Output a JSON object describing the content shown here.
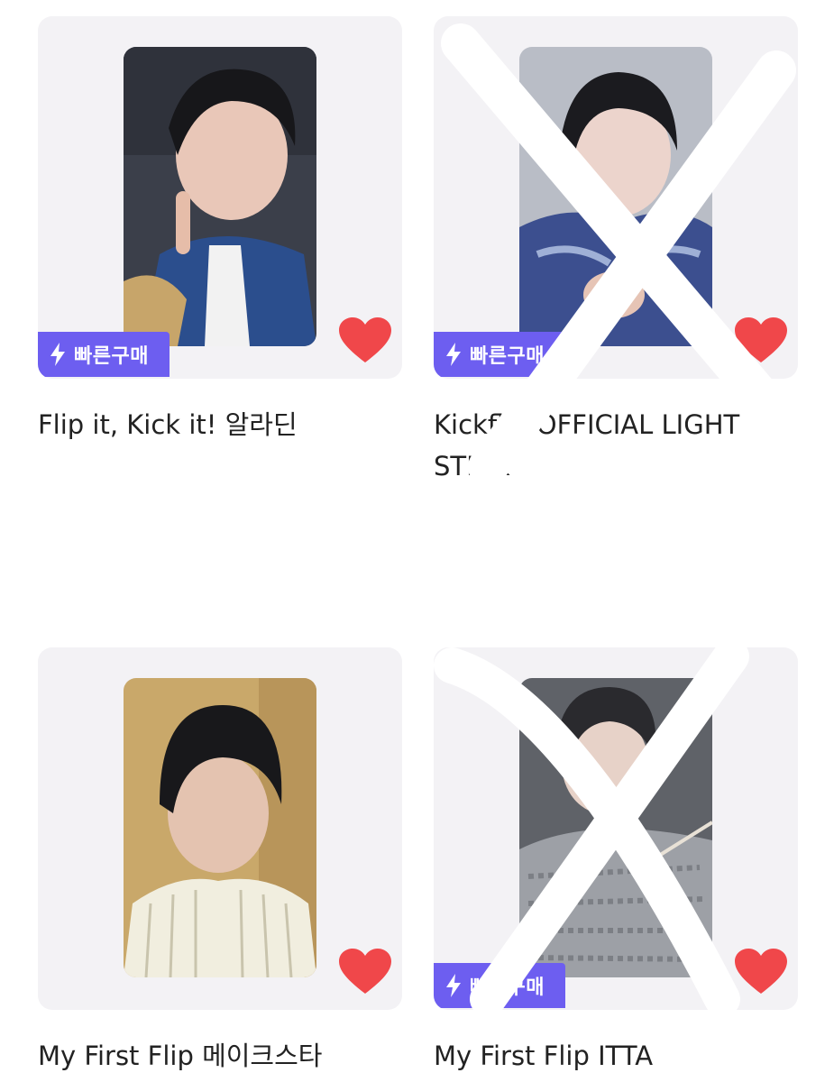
{
  "products": [
    {
      "title": "Flip it, Kick it! 알라딘",
      "badge_label": "빠른구매",
      "badge_icon": "lightning-icon",
      "liked": true,
      "crossed_out": false
    },
    {
      "title": "Kickflip OFFICIAL LIGHT STICK",
      "badge_label": "빠른구매",
      "badge_icon": "lightning-icon",
      "liked": true,
      "crossed_out": true
    },
    {
      "title": "My First Flip 메이크스타",
      "badge_label": "",
      "liked": true,
      "crossed_out": false
    },
    {
      "title": "My First Flip ITTA",
      "badge_label": "빠른구매",
      "badge_icon": "lightning-icon",
      "liked": true,
      "crossed_out": true
    }
  ],
  "colors": {
    "card_bg": "#f3f2f5",
    "badge_bg": "#6d5ef0",
    "heart": "#f0474a",
    "title_text": "#222222",
    "cross_mark": "#ffffff"
  }
}
